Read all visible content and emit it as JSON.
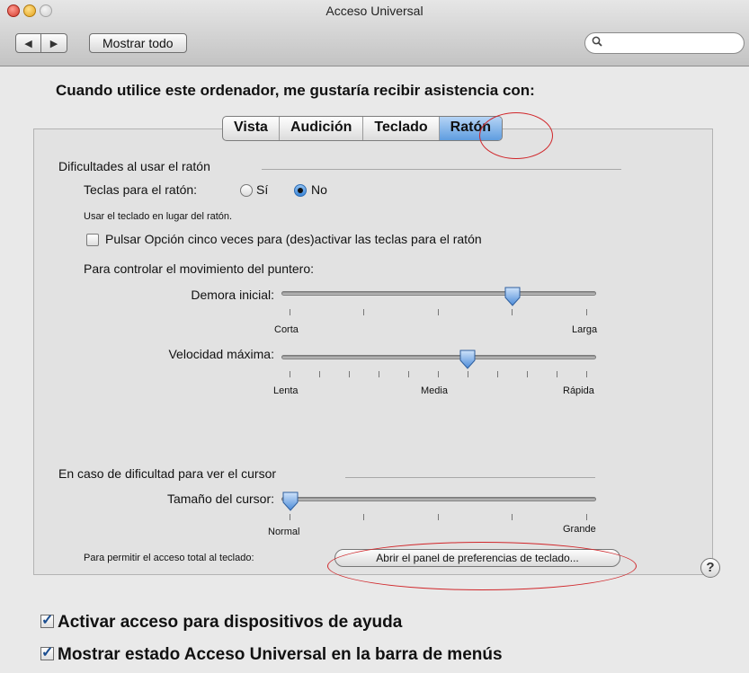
{
  "window": {
    "title": "Acceso Universal"
  },
  "toolbar": {
    "back_icon": "◀",
    "forward_icon": "▶",
    "show_all_label": "Mostrar todo",
    "search_placeholder": ""
  },
  "heading": "Cuando utilice este ordenador, me gustaría recibir asistencia con:",
  "tabs": [
    {
      "label": "Vista",
      "selected": false
    },
    {
      "label": "Audición",
      "selected": false
    },
    {
      "label": "Teclado",
      "selected": false
    },
    {
      "label": "Ratón",
      "selected": true
    }
  ],
  "mouse_section": {
    "title": "Dificultades al usar el ratón",
    "mouse_keys_label": "Teclas para el ratón:",
    "option_yes": "Sí",
    "option_no": "No",
    "selected": "No",
    "hint": "Usar el teclado en lugar del ratón.",
    "option_key_checkbox_label": "Pulsar Opción cinco veces para (des)activar las teclas para el ratón",
    "option_key_checked": false,
    "pointer_label": "Para controlar el movimiento del puntero:",
    "initial_delay": {
      "label": "Demora inicial:",
      "min_label": "Corta",
      "max_label": "Larga",
      "value": 0.74
    },
    "max_speed": {
      "label": "Velocidad máxima:",
      "min_label": "Lenta",
      "mid_label": "Media",
      "max_label": "Rápida",
      "value": 0.59
    }
  },
  "cursor_section": {
    "title": "En caso de dificultad para ver el cursor",
    "cursor_size": {
      "label": "Tamaño del cursor:",
      "min_label": "Normal",
      "max_label": "Grande",
      "value": 0.0
    },
    "keyboard_access_label": "Para permitir el acceso total al teclado:",
    "open_keyboard_prefs_button": "Abrir el panel de preferencias de teclado...",
    "help_label": "?"
  },
  "bottom": {
    "assistive_devices": {
      "label": "Activar acceso para dispositivos de ayuda",
      "checked": true
    },
    "show_in_menu_bar": {
      "label": "Mostrar estado Acceso Universal en la barra de menús",
      "checked": true
    }
  },
  "colors": {
    "annotation": "#d0262a",
    "accent": "#5f9de0"
  }
}
